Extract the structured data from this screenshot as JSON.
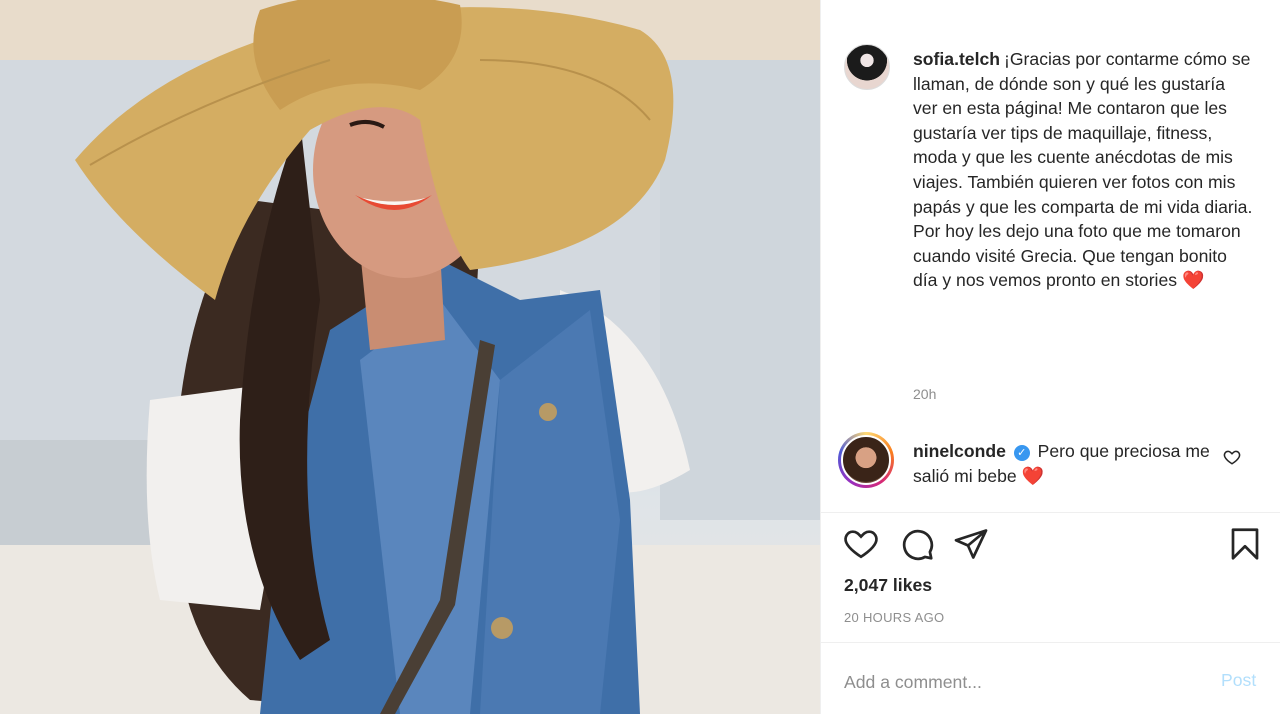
{
  "post": {
    "author": "sofia.telch",
    "caption_lines": [
      "¡Gracias por contarme cómo se llaman, de dónde son y qué les gustaría ver en esta página! Me contaron que les gustaría ver tips de maquillaje, fitness, moda y que les cuente anécdotas de mis viajes. También quieren ver fotos con mis papás y que les comparta de mi vida diaria.",
      "Por hoy les dejo una foto que me tomaron cuando visité Grecia. Que tengan bonito día y nos vemos pronto en stories"
    ],
    "caption_emoji": "❤️",
    "time_short": "20h",
    "likes": "2,047 likes",
    "time_long": "20 HOURS AGO"
  },
  "comment": {
    "author": "ninelconde",
    "text": "Pero que preciosa me salió mi bebe",
    "emoji": "❤️"
  },
  "input": {
    "placeholder": "Add a comment...",
    "post_label": "Post"
  },
  "icons": {
    "like": "heart-outline-icon",
    "comment": "speech-bubble-icon",
    "share": "paper-plane-icon",
    "save": "bookmark-icon",
    "verified": "verified-badge-icon",
    "comment_like": "small-heart-icon"
  },
  "colors": {
    "text": "#262626",
    "muted": "#8e8e8e",
    "verified": "#3897f0",
    "post_disabled": "#b2dffc",
    "heart_emoji": "#e0242b"
  }
}
